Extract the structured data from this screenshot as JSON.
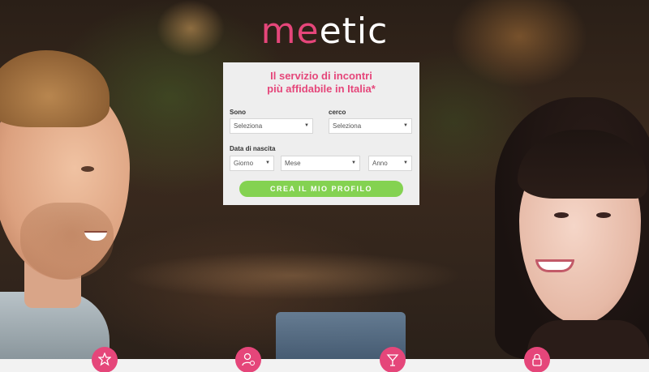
{
  "brand": {
    "logo_part1": "me",
    "logo_part2": "etic",
    "colors": {
      "accent": "#e5467a",
      "cta": "#84d251",
      "panel": "#eeeeee"
    }
  },
  "form": {
    "headline_line1": "Il servizio di incontri",
    "headline_line2": "più affidabile in Italia*",
    "sono_label": "Sono",
    "sono_value": "Seleziona",
    "cerco_label": "cerco",
    "cerco_value": "Seleziona",
    "birthdate_label": "Data di nascita",
    "day_value": "Giorno",
    "month_value": "Mese",
    "year_value": "Anno",
    "submit_label": "CREA IL MIO PROFILO"
  },
  "features": [
    {
      "icon": "star-badge-icon"
    },
    {
      "icon": "user-check-icon"
    },
    {
      "icon": "cocktail-icon"
    },
    {
      "icon": "lock-icon"
    }
  ]
}
